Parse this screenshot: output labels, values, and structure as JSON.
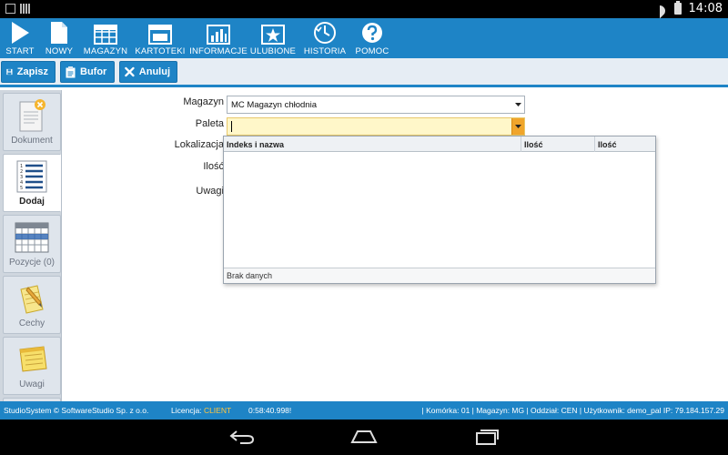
{
  "statusbar": {
    "time": "14:08"
  },
  "toolbar": {
    "items": [
      {
        "label": "START",
        "icon": "play-icon"
      },
      {
        "label": "NOWY",
        "icon": "new-document-icon"
      },
      {
        "label": "MAGAZYN",
        "icon": "warehouse-grid-icon"
      },
      {
        "label": "KARTOTEKI",
        "icon": "index-card-icon"
      },
      {
        "label": "INFORMACJE",
        "icon": "chart-info-icon"
      },
      {
        "label": "ULUBIONE",
        "icon": "star-icon"
      },
      {
        "label": "HISTORIA",
        "icon": "history-icon"
      },
      {
        "label": "POMOC",
        "icon": "help-icon"
      }
    ]
  },
  "actions": {
    "save": "Zapisz",
    "buffer": "Bufor",
    "cancel": "Anuluj"
  },
  "sidenav": {
    "items": [
      {
        "label": "Dokument",
        "icon": "document-icon"
      },
      {
        "label": "Dodaj",
        "icon": "numbered-list-icon"
      },
      {
        "label": "Pozycje (0)",
        "icon": "table-icon"
      },
      {
        "label": "Cechy",
        "icon": "note-pencil-icon"
      },
      {
        "label": "Uwagi",
        "icon": "notepad-icon"
      }
    ]
  },
  "form": {
    "magazyn_label": "Magazyn",
    "magazyn_value": "MC Magazyn chłodnia",
    "paleta_label": "Paleta",
    "paleta_value": "",
    "lokalizacja_label": "Lokalizacja",
    "ilosc_label": "Ilość",
    "uwagi_label": "Uwagi"
  },
  "popup": {
    "columns": [
      "Indeks i nazwa",
      "Ilość",
      "Ilość"
    ],
    "empty_text": "Brak danych"
  },
  "footer": {
    "company": "StudioSystem © SoftwareStudio Sp. z o.o.",
    "license_label": "Licencja:",
    "license_value": "CLIENT",
    "session_time": "0:58:40.998!",
    "info": "| Komórka: 01 | Magazyn: MG | Oddział: CEN | Użytkownik: demo_pal IP: 79.184.157.29"
  },
  "colors": {
    "accent": "#1e84c6",
    "license": "#ffc640",
    "active_field": "#fff7c9"
  }
}
